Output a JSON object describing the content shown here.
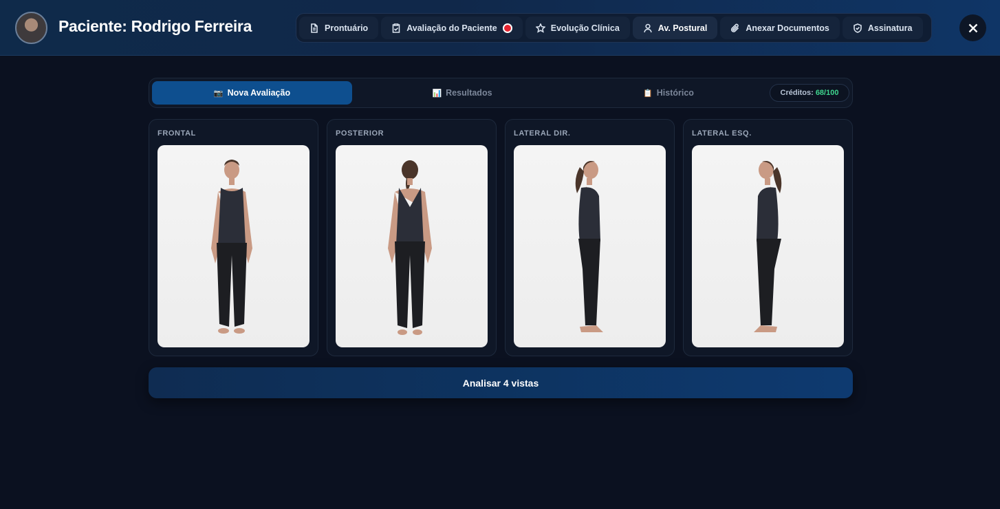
{
  "header": {
    "title": "Paciente: Rodrigo Ferreira",
    "nav": [
      {
        "label": "Prontuário",
        "icon": "document-icon"
      },
      {
        "label": "Avaliação do Paciente",
        "icon": "clipboard-icon",
        "badge": "red-dot"
      },
      {
        "label": "Evolução Clínica",
        "icon": "star-icon"
      },
      {
        "label": "Av. Postural",
        "icon": "user-icon"
      },
      {
        "label": "Anexar Documentos",
        "icon": "paperclip-icon"
      },
      {
        "label": "Assinatura",
        "icon": "shield-icon"
      }
    ],
    "active_nav": "Av. Postural"
  },
  "tabs": [
    {
      "icon": "📷",
      "label": "Nova Avaliação"
    },
    {
      "icon": "📊",
      "label": "Resultados"
    },
    {
      "icon": "📋",
      "label": "Histórico"
    }
  ],
  "credits": {
    "label": "Créditos:",
    "value": "68/100"
  },
  "views": [
    {
      "label": "FRONTAL"
    },
    {
      "label": "POSTERIOR"
    },
    {
      "label": "LATERAL DIR."
    },
    {
      "label": "LATERAL ESQ."
    }
  ],
  "analyze_label": "Analisar 4 vistas",
  "colors": {
    "accent": "#0e4f8f",
    "credits_value": "#3fd58e",
    "alert": "#e5232f"
  }
}
